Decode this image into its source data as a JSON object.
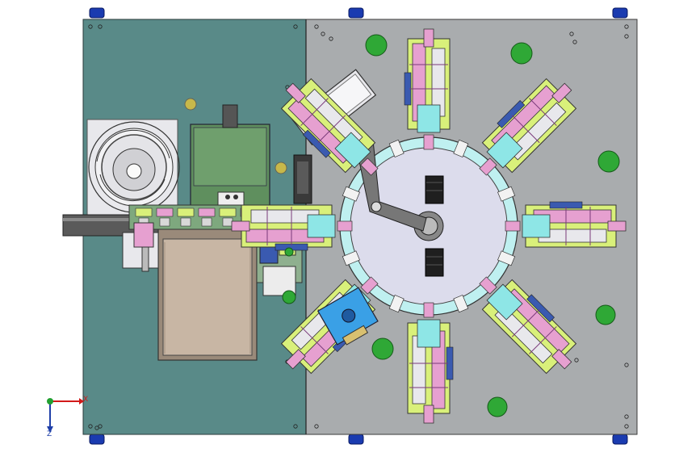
{
  "axis_triad": {
    "x_label": "X",
    "z_label": "Z"
  },
  "colors": {
    "background": "#ffffff",
    "left_plate": "#598a88",
    "right_plate": "#a9acae",
    "turntable": "#dcdcec",
    "ring": "#bff0f0",
    "bowl_base": "#e8e8ec",
    "green_block": "#5f8f5e",
    "tan_tray": "#c8b6a4",
    "gold": "#c7b84a",
    "lime": "#d9f07a",
    "pink": "#e6a0d0",
    "cyan": "#8ee6e6",
    "blue_fixture": "#3aa0e6",
    "green_mark": "#2fa836",
    "foot_blue": "#1a3bb0"
  },
  "stations": {
    "count": 8
  }
}
